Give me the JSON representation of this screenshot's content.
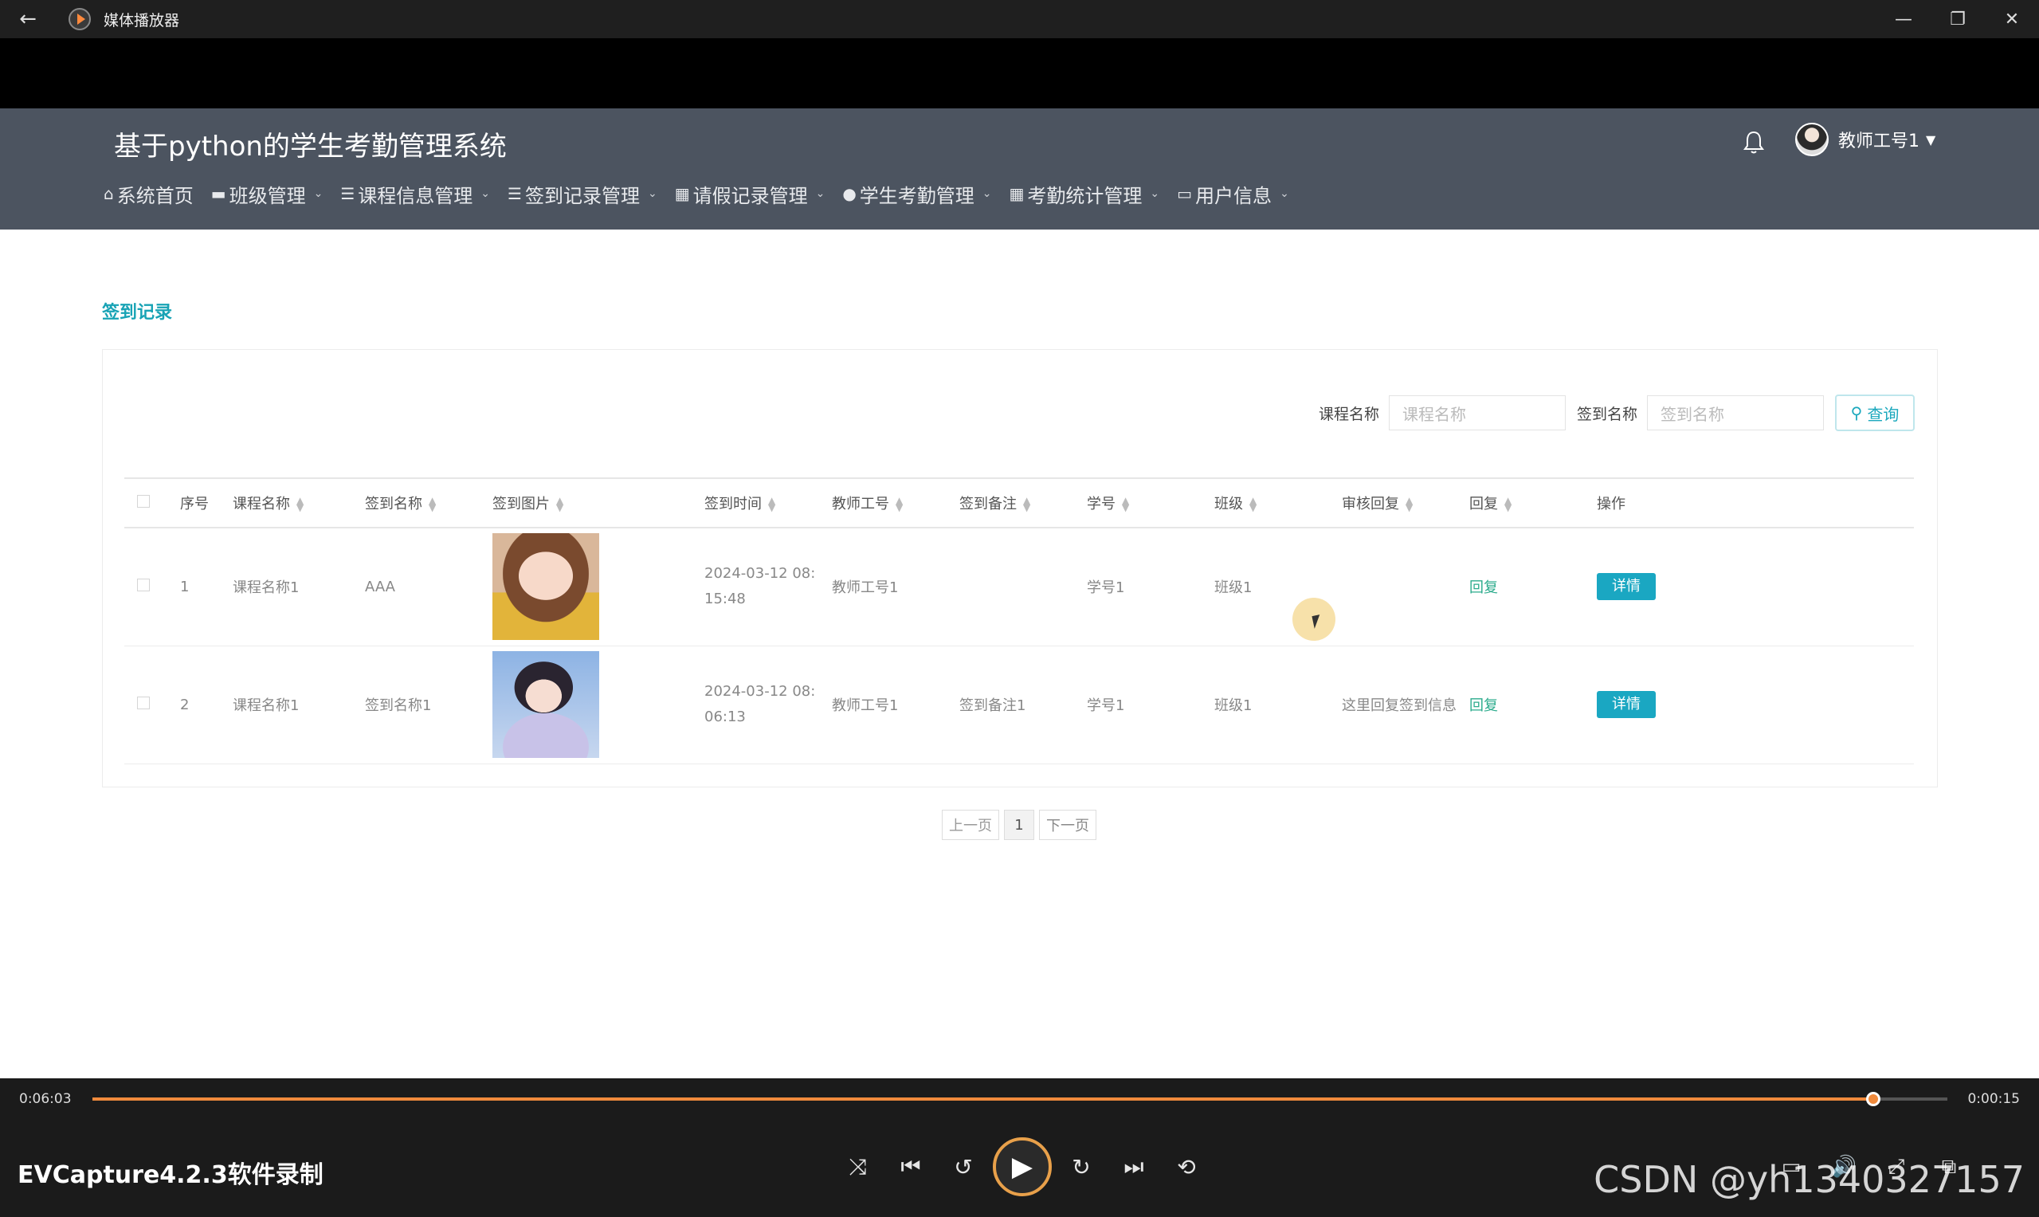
{
  "window": {
    "title": "媒体播放器",
    "back_icon": "←",
    "controls": [
      "—",
      "❐",
      "✕"
    ]
  },
  "app": {
    "title": "基于python的学生考勤管理系统",
    "user_name": "教师工号1",
    "nav": [
      {
        "icon": "⌂",
        "label": "系统首页"
      },
      {
        "icon": "▬",
        "label": "班级管理"
      },
      {
        "icon": "☰",
        "label": "课程信息管理"
      },
      {
        "icon": "☰",
        "label": "签到记录管理"
      },
      {
        "icon": "▦",
        "label": "请假记录管理"
      },
      {
        "icon": "●",
        "label": "学生考勤管理"
      },
      {
        "icon": "▦",
        "label": "考勤统计管理"
      },
      {
        "icon": "▭",
        "label": "用户信息"
      }
    ],
    "breadcrumb": "签到记录",
    "search": {
      "course_label": "课程名称",
      "course_placeholder": "课程名称",
      "sign_label": "签到名称",
      "sign_placeholder": "签到名称",
      "query_label": "查询"
    },
    "table": {
      "headers": [
        "序号",
        "课程名称",
        "签到名称",
        "签到图片",
        "签到时间",
        "教师工号",
        "签到备注",
        "学号",
        "班级",
        "审核回复",
        "回复",
        "操作"
      ],
      "rows": [
        {
          "index": "1",
          "course": "课程名称1",
          "sign_name": "AAA",
          "time_line1": "2024-03-12 08:",
          "time_line2": "15:48",
          "teacher": "教师工号1",
          "note": "",
          "student_no": "学号1",
          "class_name": "班级1",
          "audit_reply": "",
          "reply": "回复",
          "action": "详情"
        },
        {
          "index": "2",
          "course": "课程名称1",
          "sign_name": "签到名称1",
          "time_line1": "2024-03-12 08:",
          "time_line2": "06:13",
          "teacher": "教师工号1",
          "note": "签到备注1",
          "student_no": "学号1",
          "class_name": "班级1",
          "audit_reply": "这里回复签到信息",
          "reply": "回复",
          "action": "详情"
        }
      ]
    },
    "pager": {
      "prev": "上一页",
      "current": "1",
      "next": "下一页"
    }
  },
  "player": {
    "elapsed": "0:06:03",
    "remaining": "0:00:15",
    "progress": 0.96,
    "watermark_left": "EVCapture4.2.3软件录制",
    "watermark_right": "CSDN @yh1340327157",
    "accent": "#f08a3c"
  }
}
